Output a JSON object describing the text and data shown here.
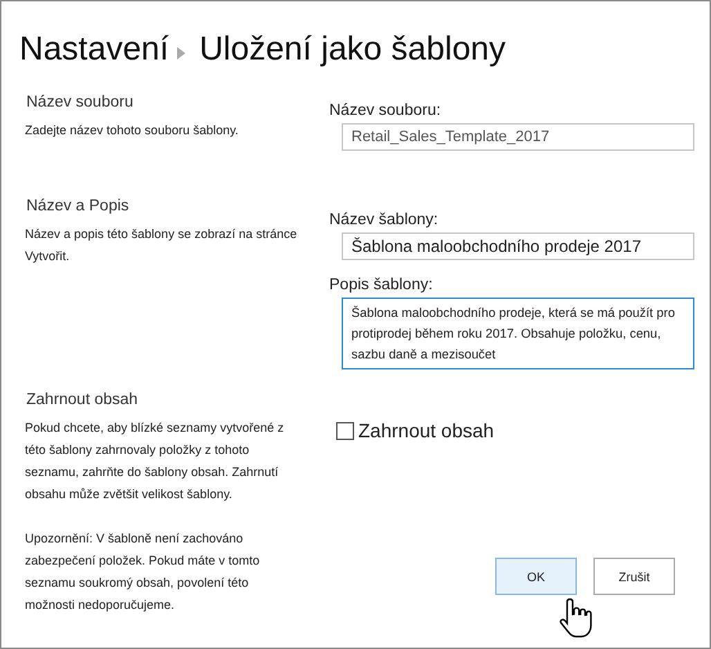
{
  "breadcrumb": {
    "parent": "Nastavení",
    "title": "Uložení jako šablony"
  },
  "sections": [
    {
      "kind": "file",
      "heading": "Název souboru",
      "description": "Zadejte název tohoto souboru šablony.",
      "fields": [
        {
          "label": "Název souboru:",
          "value": "Retail_Sales_Template_2017",
          "kind": "input",
          "focused": false
        }
      ]
    },
    {
      "kind": "title",
      "heading": "Název a Popis",
      "description": "Název a popis této šablony se zobrazí na stránce Vytvořit.",
      "fields": [
        {
          "label": "Název šablony:",
          "value": "Šablona maloobchodního prodeje 2017",
          "kind": "input",
          "focused": false
        },
        {
          "label": "Popis šablony:",
          "value": "Šablona maloobchodního prodeje, která se má použít pro protiprodej během roku 2017. Obsahuje položku, cenu, sazbu daně a mezisoučet",
          "kind": "textarea",
          "focused": true
        }
      ]
    },
    {
      "kind": "content",
      "heading": "Zahrnout obsah",
      "description": "Pokud chcete, aby blízké seznamy vytvořené z této šablony zahrnovaly položky z tohoto seznamu, zahrňte do šablony obsah. Zahrnutí obsahu může zvětšit velikost šablony.",
      "warning": "Upozornění: V šabloně není zachováno zabezpečení položek. Pokud máte v tomto seznamu soukromý obsah, povolení této možnosti nedoporučujeme.",
      "checkbox": {
        "label": "Zahrnout obsah",
        "checked": false
      }
    }
  ],
  "buttons": [
    {
      "label": "OK",
      "hovered": true
    },
    {
      "label": "Zrušit",
      "hovered": false
    }
  ]
}
